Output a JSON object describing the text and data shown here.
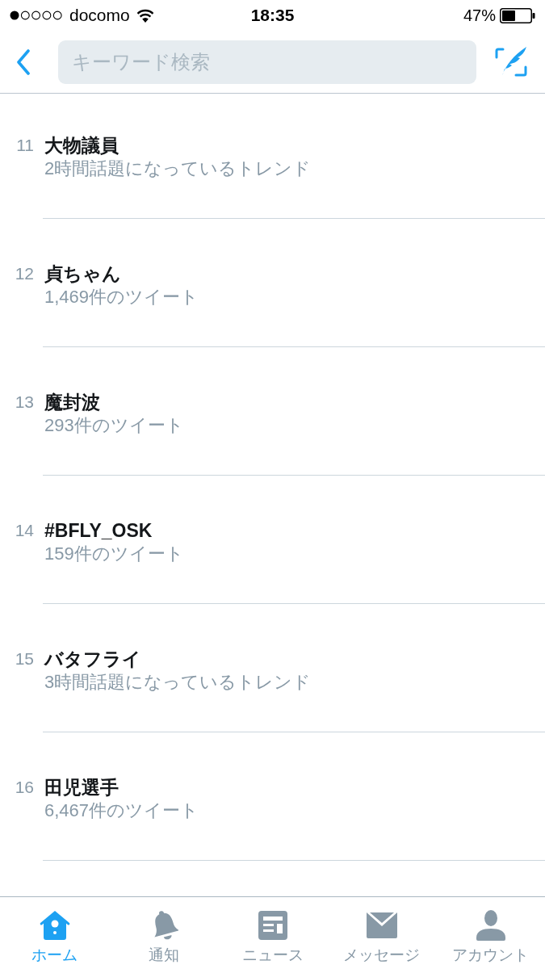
{
  "status_bar": {
    "carrier": "docomo",
    "time": "18:35",
    "battery": "47%",
    "level": 0.47
  },
  "header": {
    "search": {
      "placeholder": "キーワード検索"
    }
  },
  "trends": [
    {
      "rank": "11",
      "name": "大物議員",
      "meta": "2時間話題になっているトレンド"
    },
    {
      "rank": "12",
      "name": "貞ちゃん",
      "meta": "1,469件のツイート"
    },
    {
      "rank": "13",
      "name": "魔封波",
      "meta": "293件のツイート"
    },
    {
      "rank": "14",
      "name": "#BFLY_OSK",
      "meta": "159件のツイート"
    },
    {
      "rank": "15",
      "name": "バタフライ",
      "meta": "3時間話題になっているトレンド"
    },
    {
      "rank": "16",
      "name": "田児選手",
      "meta": "6,467件のツイート"
    }
  ],
  "tab_bar": [
    {
      "kind": "home",
      "label": "ホーム",
      "selected": true
    },
    {
      "kind": "notifications",
      "label": "通知",
      "selected": false
    },
    {
      "kind": "news",
      "label": "ニュース",
      "selected": false
    },
    {
      "kind": "messages",
      "label": "メッセージ",
      "selected": false
    },
    {
      "kind": "account",
      "label": "アカウント",
      "selected": false
    }
  ]
}
